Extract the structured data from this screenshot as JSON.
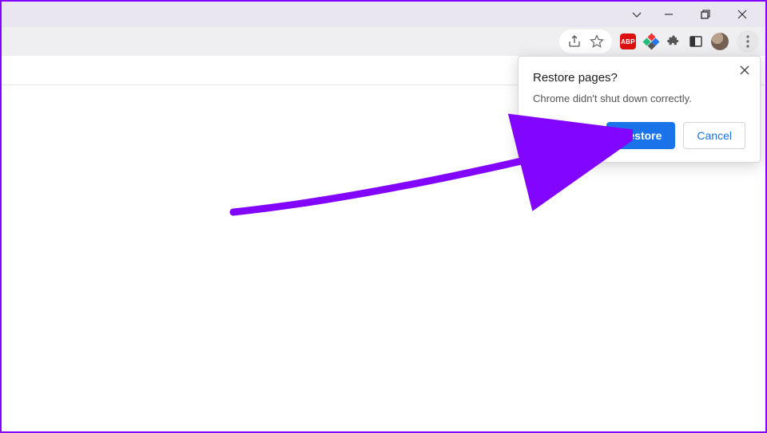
{
  "window": {
    "chev_label": "chevron",
    "minimize_label": "minimize",
    "maximize_label": "maximize",
    "close_label": "close"
  },
  "toolbar": {
    "share_label": "share",
    "star_label": "bookmark",
    "abp_label": "ABP",
    "ext2_label": "extension",
    "puzzle_label": "extensions",
    "panel_label": "side-panel",
    "avatar_label": "profile",
    "menu_label": "menu"
  },
  "dialog": {
    "title": "Restore pages?",
    "message": "Chrome didn't shut down correctly.",
    "primary": "Restore",
    "secondary": "Cancel",
    "close_label": "close"
  },
  "colors": {
    "accent": "#1a73e8",
    "annotation": "#8205ff"
  }
}
